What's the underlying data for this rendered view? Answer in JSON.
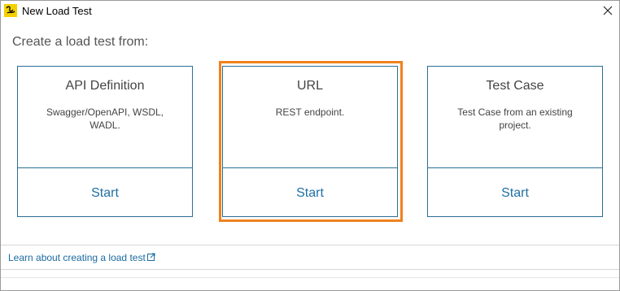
{
  "window": {
    "title": "New Load Test",
    "close_icon": "close-icon",
    "app_icon": "soapui-logo-icon"
  },
  "prompt": "Create a load test from:",
  "cards": [
    {
      "name": "API Definition",
      "desc_lines": [
        "Swagger/OpenAPI, WSDL,",
        "WADL."
      ],
      "start": "Start",
      "selected": false
    },
    {
      "name": "URL",
      "desc_lines": [
        "REST endpoint."
      ],
      "start": "Start",
      "selected": true
    },
    {
      "name": "Test Case",
      "desc_lines": [
        "Test Case from an existing",
        "project."
      ],
      "start": "Start",
      "selected": false
    }
  ],
  "footer": {
    "learn_link": "Learn about creating a load test",
    "external_icon": "external-link-icon"
  },
  "colors": {
    "accent": "#1f6fa3",
    "card_border": "#2a6f94",
    "selected_border": "#f0821e"
  }
}
